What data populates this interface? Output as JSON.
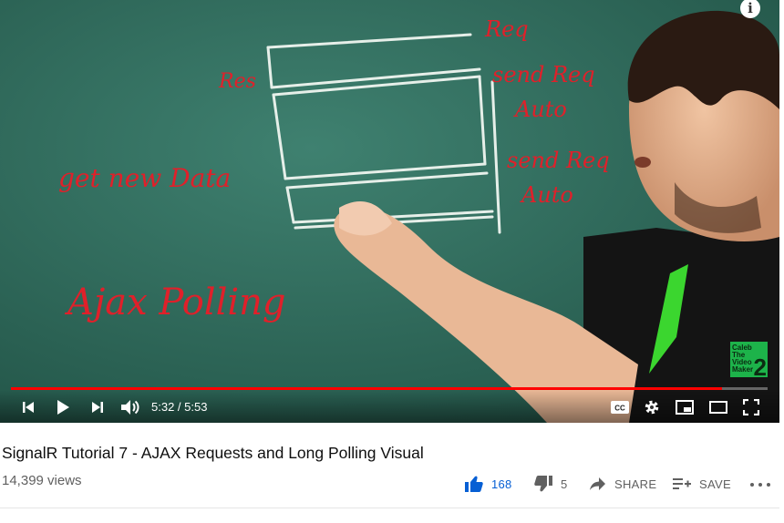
{
  "video": {
    "title": "SignalR Tutorial 7 - AJAX Requests and Long Polling Visual",
    "views": "14,399 views",
    "progress_fraction": 0.94
  },
  "player": {
    "time_display": "5:32 / 5:53",
    "info_glyph": "i",
    "watermark": {
      "line1": "Caleb",
      "line2": "The",
      "line3": "Video",
      "line4": "Maker",
      "mark": "2"
    },
    "board_text": {
      "req": "Req",
      "res": "Res",
      "send_req_1": "send Req",
      "auto_1": "Auto",
      "send_req_2": "send Req",
      "auto_2": "Auto",
      "get_new_data": "get new Data",
      "ajax_polling": "Ajax Polling"
    },
    "controls": [
      "previous-icon",
      "play-icon",
      "next-icon",
      "volume-icon",
      "captions-icon",
      "settings-icon",
      "miniplayer-icon",
      "theater-icon",
      "fullscreen-icon"
    ]
  },
  "actions": {
    "like_count": "168",
    "dislike_count": "5",
    "share_label": "SHARE",
    "save_label": "SAVE"
  },
  "colors": {
    "progress": "#ff0000",
    "liked": "#065fd4",
    "muted_text": "#606060"
  }
}
